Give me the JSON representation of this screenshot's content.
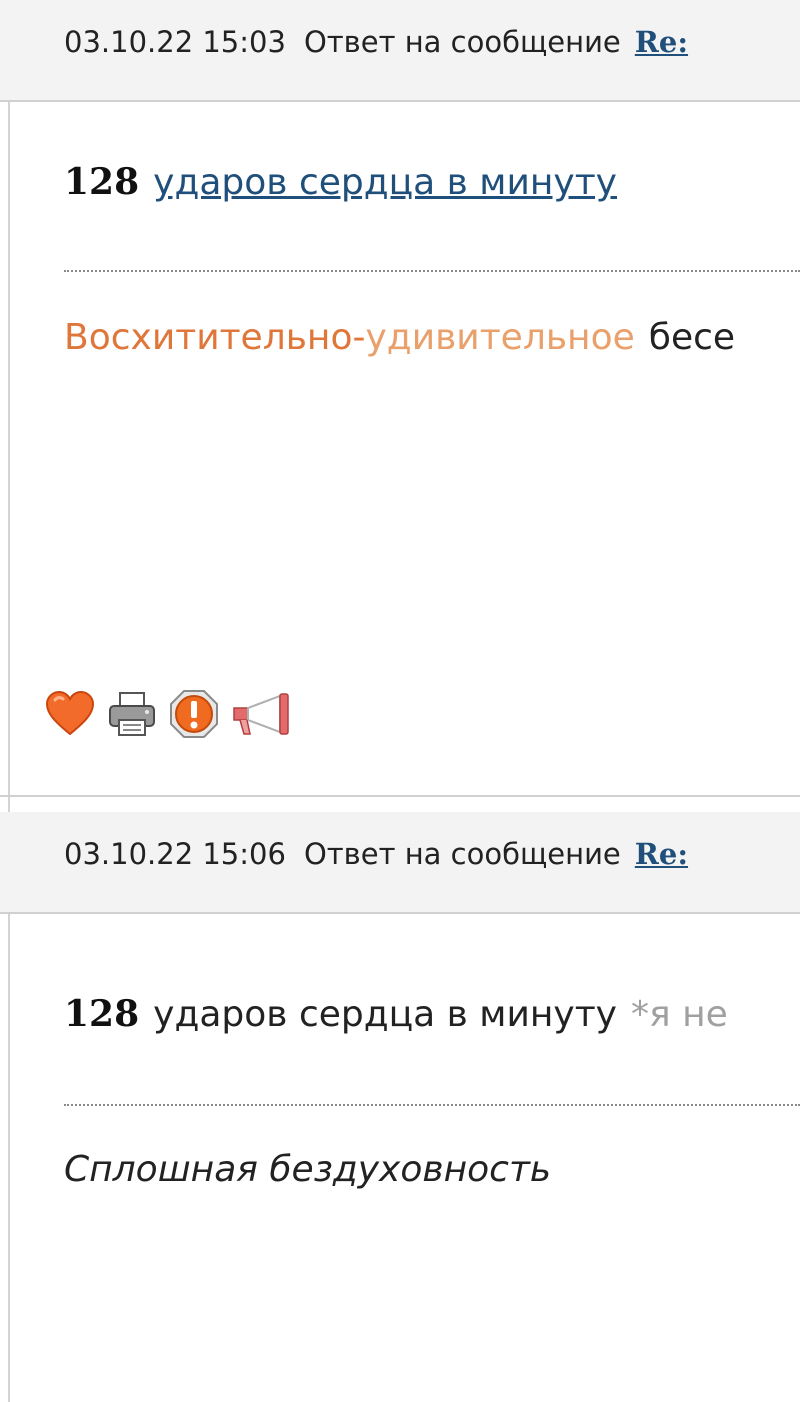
{
  "posts": [
    {
      "date": "03.10.22 15:03",
      "reply_label": "Ответ на сообщение",
      "reply_link": "Re:",
      "count": "128",
      "title_link": "ударов сердца в минуту",
      "body_parts": [
        "Восхитительно",
        "-",
        "удивительное",
        "бесе"
      ],
      "actions": [
        "heart-icon",
        "print-icon",
        "alert-icon",
        "megaphone-icon"
      ]
    },
    {
      "date": "03.10.22 15:06",
      "reply_label": "Ответ на сообщение",
      "reply_link": "Re:",
      "count": "128",
      "title_text": "ударов сердца в минуту",
      "title_note": "*я не",
      "body_italic": "Сплошная бездуховность"
    }
  ],
  "colors": {
    "link": "#1f4f7a",
    "accent_orange": "#e0773a",
    "accent_light_orange": "#e9a06a",
    "note_gray": "#a0a0a0"
  }
}
